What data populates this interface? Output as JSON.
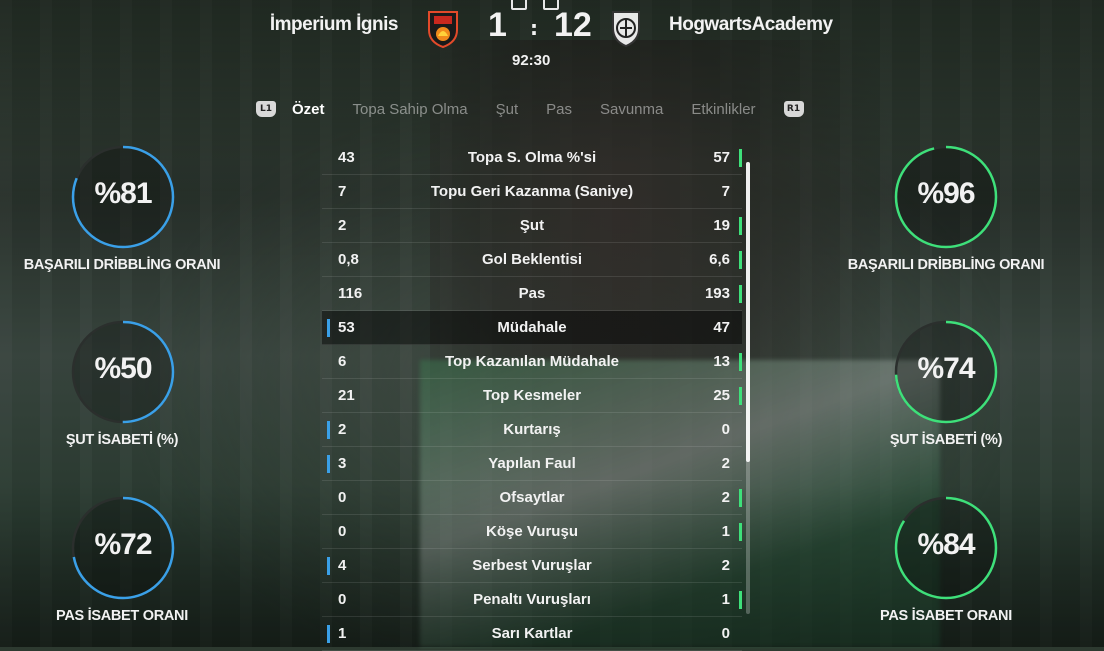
{
  "header": {
    "home_team": "İmperium İgnis",
    "away_team": "HogwartsAcademy",
    "home_score": "1",
    "separator": ":",
    "away_score": "12",
    "clock": "92:30"
  },
  "tabs": {
    "left_shoulder": "L1",
    "right_shoulder": "R1",
    "items": [
      "Özet",
      "Topa Sahip Olma",
      "Şut",
      "Pas",
      "Savunma",
      "Etkinlikler"
    ],
    "active": "Özet"
  },
  "left_panel": [
    {
      "value": "%81",
      "label": "BAŞARILI DRİBBLİNG ORANI",
      "percent": 81
    },
    {
      "value": "%50",
      "label": "ŞUT İSABETİ (%)",
      "percent": 50
    },
    {
      "value": "%72",
      "label": "PAS İSABET ORANI",
      "percent": 72
    }
  ],
  "right_panel": [
    {
      "value": "%96",
      "label": "BAŞARILI DRİBBLİNG ORANI",
      "percent": 96
    },
    {
      "value": "%74",
      "label": "ŞUT İSABETİ (%)",
      "percent": 74
    },
    {
      "value": "%84",
      "label": "PAS İSABET ORANI",
      "percent": 84
    }
  ],
  "colors": {
    "home_accent": "#3aa0e8",
    "away_accent": "#3ee07a",
    "ring_track": "#2b2f2d"
  },
  "stats": [
    {
      "home": "43",
      "name": "Topa S. Olma %'si",
      "away": "57",
      "leader": "away",
      "highlight": false
    },
    {
      "home": "7",
      "name": "Topu Geri Kazanma (Saniye)",
      "away": "7",
      "leader": "none",
      "highlight": false
    },
    {
      "home": "2",
      "name": "Şut",
      "away": "19",
      "leader": "away",
      "highlight": false
    },
    {
      "home": "0,8",
      "name": "Gol Beklentisi",
      "away": "6,6",
      "leader": "away",
      "highlight": false
    },
    {
      "home": "116",
      "name": "Pas",
      "away": "193",
      "leader": "away",
      "highlight": false
    },
    {
      "home": "53",
      "name": "Müdahale",
      "away": "47",
      "leader": "home",
      "highlight": true
    },
    {
      "home": "6",
      "name": "Top Kazanılan Müdahale",
      "away": "13",
      "leader": "away",
      "highlight": false
    },
    {
      "home": "21",
      "name": "Top Kesmeler",
      "away": "25",
      "leader": "away",
      "highlight": false
    },
    {
      "home": "2",
      "name": "Kurtarış",
      "away": "0",
      "leader": "home",
      "highlight": false
    },
    {
      "home": "3",
      "name": "Yapılan Faul",
      "away": "2",
      "leader": "home",
      "highlight": false
    },
    {
      "home": "0",
      "name": "Ofsaytlar",
      "away": "2",
      "leader": "away",
      "highlight": false
    },
    {
      "home": "0",
      "name": "Köşe Vuruşu",
      "away": "1",
      "leader": "away",
      "highlight": false
    },
    {
      "home": "4",
      "name": "Serbest Vuruşlar",
      "away": "2",
      "leader": "home",
      "highlight": false
    },
    {
      "home": "0",
      "name": "Penaltı Vuruşları",
      "away": "1",
      "leader": "away",
      "highlight": false
    },
    {
      "home": "1",
      "name": "Sarı Kartlar",
      "away": "0",
      "leader": "home",
      "highlight": false
    }
  ]
}
